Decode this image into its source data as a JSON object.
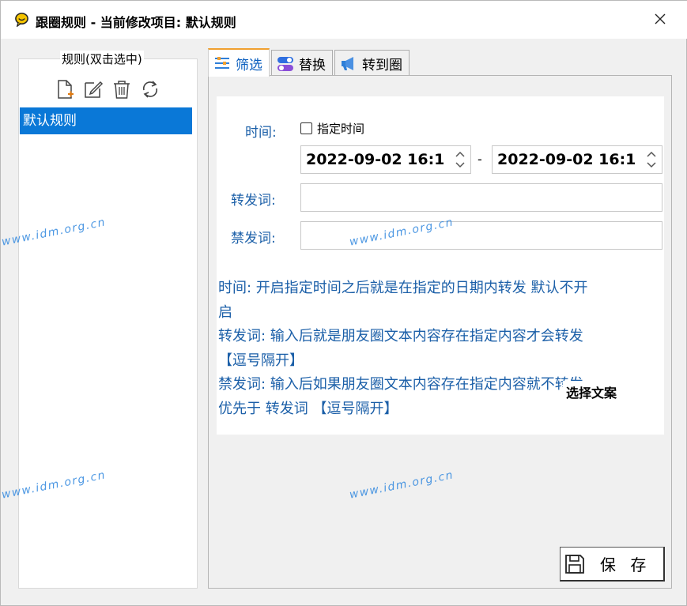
{
  "window": {
    "title": "跟圈规则 - 当前修改项目: 默认规则"
  },
  "rules_panel": {
    "legend": "规则(双击选中)",
    "items": [
      "默认规则"
    ]
  },
  "tabs": [
    {
      "label": "筛选",
      "active": true
    },
    {
      "label": "替换",
      "active": false
    },
    {
      "label": "转到圈",
      "active": false
    }
  ],
  "filter": {
    "time_label": "时间:",
    "specify_time_checkbox": "指定时间",
    "start_datetime": "2022-09-02 16:1",
    "separator": "-",
    "end_datetime": "2022-09-02 16:1",
    "forward_words_label": "转发词:",
    "forward_words_value": "",
    "forbidden_words_label": "禁发词:",
    "forbidden_words_value": ""
  },
  "help": {
    "lines": [
      "时间: 开启指定时间之后就是在指定的日期内转发 默认不开",
      "启",
      "转发词: 输入后就是朋友圈文本内容存在指定内容才会转发",
      "【逗号隔开】",
      "禁发词: 输入后如果朋友圈文本内容存在指定内容就不转发",
      "优先于 转发词 【逗号隔开】"
    ]
  },
  "buttons": {
    "choose_copy": "选择文案",
    "save": "保 存"
  },
  "watermarks": [
    "www.idm.org.cn",
    "www.idm.org.cn",
    "www.idm.org.cn",
    "www.idm.org.cn"
  ],
  "colors": {
    "accent": "#0a78d7",
    "label_blue": "#1b5fa8",
    "tab_active_top": "#f0a030"
  }
}
